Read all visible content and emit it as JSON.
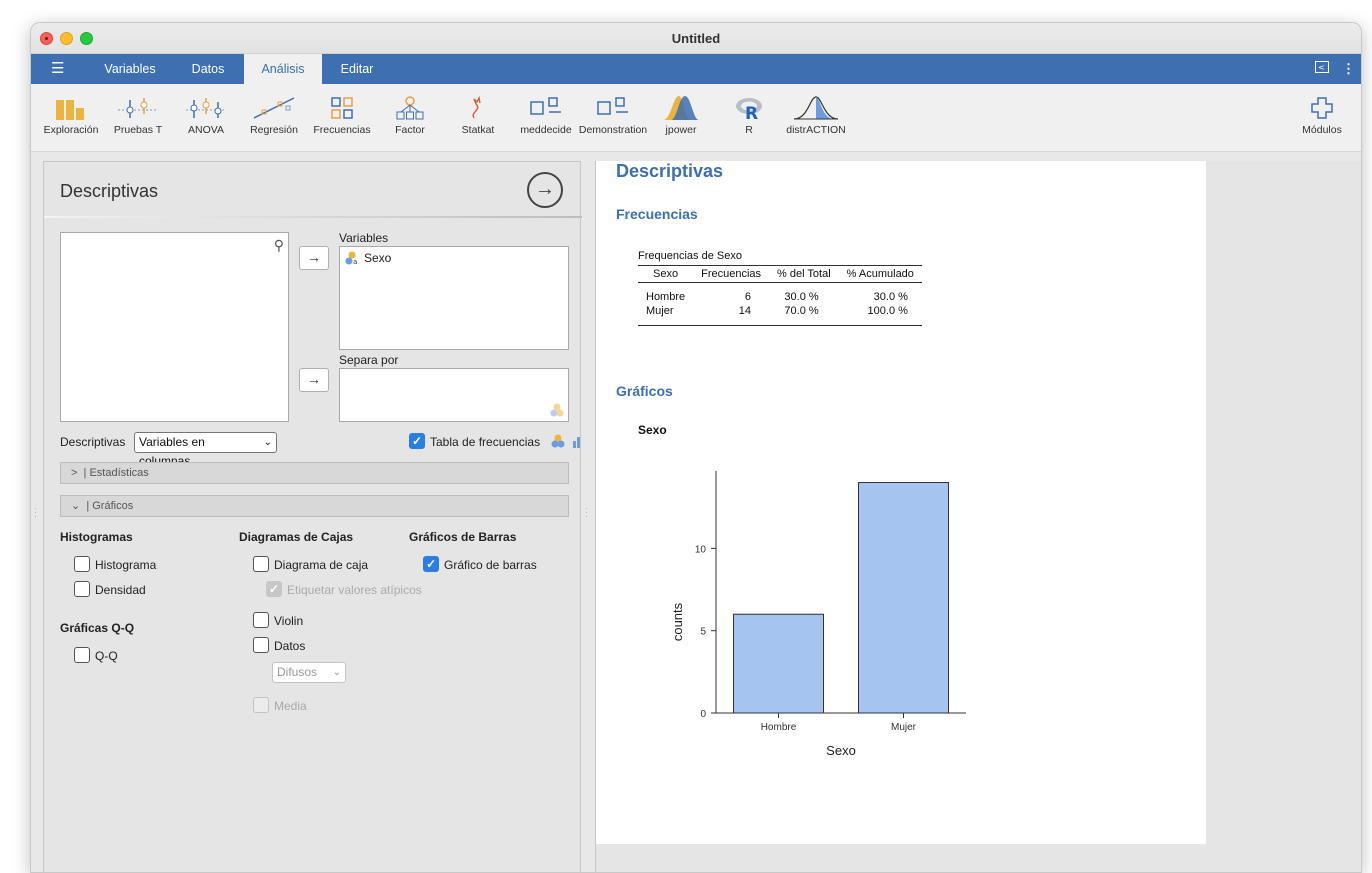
{
  "window": {
    "title": "Untitled"
  },
  "menu": {
    "tabs": [
      "Variables",
      "Datos",
      "Análisis",
      "Editar"
    ],
    "active": "Análisis"
  },
  "ribbon": {
    "items": [
      "Exploración",
      "Pruebas T",
      "ANOVA",
      "Regresión",
      "Frecuencias",
      "Factor",
      "Statkat",
      "meddecide",
      "Demonstration",
      "jpower",
      "R",
      "distrACTION"
    ],
    "modules": "Módulos"
  },
  "panel": {
    "title": "Descriptivas",
    "variables_label": "Variables",
    "variables": [
      "Sexo"
    ],
    "split_label": "Separa por",
    "descriptivas_label": "Descriptivas",
    "descriptivas_select": "Variables en columnas",
    "freq_table_label": "Tabla de frecuencias",
    "estadisticas_label": "Estadísticas",
    "graficos_label": "Gráficos",
    "histogramas": {
      "heading": "Histogramas",
      "histograma": "Histograma",
      "densidad": "Densidad"
    },
    "qq": {
      "heading": "Gráficas Q-Q",
      "qq": "Q-Q"
    },
    "cajas": {
      "heading": "Diagramas de Cajas",
      "caja": "Diagrama de caja",
      "atipicos": "Etiquetar valores atípicos",
      "violin": "Violin",
      "datos": "Datos",
      "datos_select": "Difusos",
      "media": "Media"
    },
    "barras": {
      "heading": "Gráficos de Barras",
      "barras": "Gráfico de barras"
    }
  },
  "results": {
    "title": "Descriptivas",
    "freq_heading": "Frecuencias",
    "table_caption": "Frequencias de Sexo",
    "table_headers": [
      "Sexo",
      "Frecuencias",
      "% del Total",
      "% Acumulado"
    ],
    "table_rows": [
      [
        "Hombre",
        "6",
        "30.0 %",
        "30.0 %"
      ],
      [
        "Mujer",
        "14",
        "70.0 %",
        "100.0 %"
      ]
    ],
    "graphs_heading": "Gráficos",
    "plot_title": "Sexo"
  },
  "chart_data": {
    "type": "bar",
    "categories": [
      "Hombre",
      "Mujer"
    ],
    "values": [
      6,
      14
    ],
    "xlabel": "Sexo",
    "ylabel": "counts",
    "yticks": [
      0,
      5,
      10
    ],
    "ylim": [
      0,
      14.7
    ],
    "color": "#a6c4f0",
    "grid": false
  }
}
